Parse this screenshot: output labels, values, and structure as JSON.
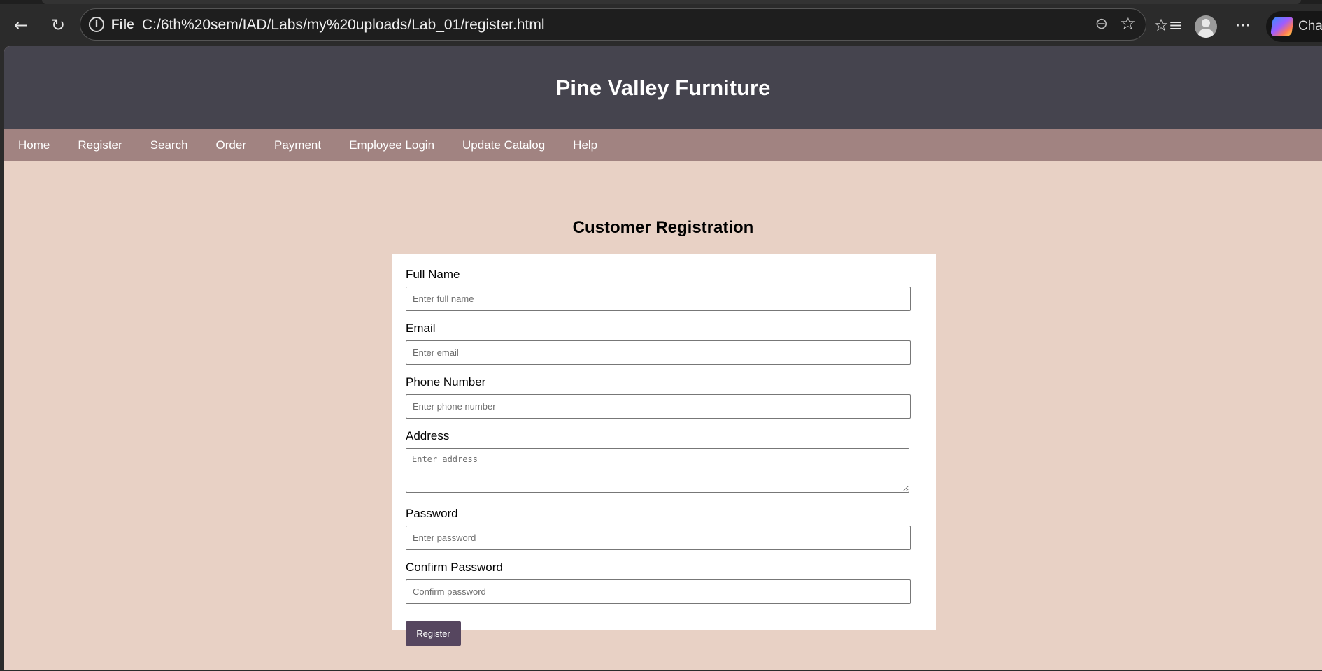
{
  "browser": {
    "address_scheme": "File",
    "url": "C:/6th%20sem/IAD/Labs/my%20uploads/Lab_01/register.html",
    "copilot_label": "Cha"
  },
  "site": {
    "title": "Pine Valley Furniture",
    "nav": [
      "Home",
      "Register",
      "Search",
      "Order",
      "Payment",
      "Employee Login",
      "Update Catalog",
      "Help"
    ]
  },
  "form": {
    "heading": "Customer Registration",
    "fields": [
      {
        "label": "Full Name",
        "placeholder": "Enter full name",
        "value": ""
      },
      {
        "label": "Email",
        "placeholder": "Enter email",
        "value": ""
      },
      {
        "label": "Phone Number",
        "placeholder": "Enter phone number",
        "value": ""
      },
      {
        "label": "Address",
        "placeholder": "Enter address",
        "value": ""
      },
      {
        "label": "Password",
        "placeholder": "Enter password",
        "value": ""
      },
      {
        "label": "Confirm Password",
        "placeholder": "Confirm password",
        "value": ""
      }
    ],
    "submit_label": "Register"
  },
  "colors": {
    "header_bg": "#45444e",
    "nav_bg": "#a18381",
    "page_bg": "#e8d1c5",
    "button_bg": "#56465f"
  }
}
